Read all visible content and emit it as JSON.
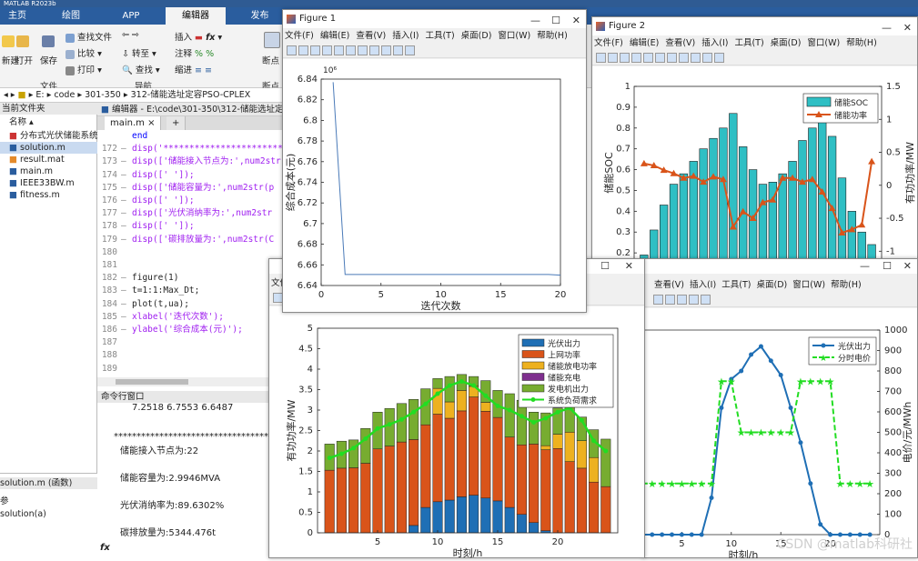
{
  "app": {
    "title_fragment": "MATLAB R2023b"
  },
  "ribbon": {
    "tabs": [
      "主页",
      "绘图",
      "APP",
      "编辑器",
      "发布"
    ],
    "active_tab": "编辑器",
    "buttons": {
      "new": "新建",
      "open": "打开",
      "save": "保存",
      "find_files": "查找文件",
      "compare": "比较",
      "print": "打印",
      "goto": "转至",
      "find": "查找",
      "insert": "插入",
      "comment": "注释",
      "indent": "缩进",
      "breakpoint": "断点"
    },
    "groups": {
      "file": "文件",
      "nav": "导航",
      "breakpoint": "断点"
    }
  },
  "address": {
    "path": [
      "E:",
      "code",
      "301-350",
      "312-储能选址定容PSO-CPLEX"
    ]
  },
  "file_browser": {
    "header": "当前文件夹",
    "col_name": "名称",
    "items": [
      "分布式光伏储能系统的...",
      "solution.m",
      "result.mat",
      "main.m",
      "IEEE33BW.m",
      "fitness.m"
    ],
    "selected": "solution.m",
    "detail_title": "solution.m (函数)",
    "detail_section": "参",
    "detail_item": "solution(a)"
  },
  "editor": {
    "header": "编辑器 - E:\\code\\301-350\\312-储能选址定容PSO-CPLEX\\main.m",
    "tab": "main.m",
    "lines": [
      {
        "n": "",
        "code": "end"
      },
      {
        "n": "172",
        "code": "disp('************************"
      },
      {
        "n": "173",
        "code": "disp(['储能接入节点为:',num2str"
      },
      {
        "n": "174",
        "code": "disp(['  ']);"
      },
      {
        "n": "175",
        "code": "disp(['储能容量为:',num2str(p"
      },
      {
        "n": "176",
        "code": "disp(['  ']);"
      },
      {
        "n": "177",
        "code": "disp(['光伏消纳率为:',num2str"
      },
      {
        "n": "178",
        "code": "disp(['  ']);"
      },
      {
        "n": "179",
        "code": "disp(['碳排放量为:',num2str(C"
      },
      {
        "n": "180",
        "code": ""
      },
      {
        "n": "181",
        "code": ""
      },
      {
        "n": "182",
        "code": "figure(1)"
      },
      {
        "n": "183",
        "code": "t=1:1:Max_Dt;"
      },
      {
        "n": "184",
        "code": "plot(t,ua);"
      },
      {
        "n": "185",
        "code": "xlabel('迭代次数');"
      },
      {
        "n": "186",
        "code": "ylabel('综合成本(元)');"
      },
      {
        "n": "187",
        "code": ""
      },
      {
        "n": "188",
        "code": ""
      },
      {
        "n": "189",
        "code": ""
      }
    ]
  },
  "command_window": {
    "header": "命令行窗口",
    "lines": [
      "7.2518      6.7553      6.6487",
      "***********************************",
      "储能接入节点为:22",
      "储能容量为:2.9946MVA",
      "光伏消纳率为:89.6302%",
      "碳排放量为:5344.476t"
    ],
    "prompt": "fx"
  },
  "figure_menu": [
    "文件(F)",
    "编辑(E)",
    "查看(V)",
    "插入(I)",
    "工具(T)",
    "桌面(D)",
    "窗口(W)",
    "帮助(H)"
  ],
  "figures": {
    "fig1_title": "Figure 1",
    "fig2_title": "Figure 2",
    "fig3_menu_partial": [
      "文件"
    ],
    "fig4_menu_partial": [
      "查看(V)",
      "插入(I)",
      "工具(T)",
      "桌面(D)",
      "窗口(W)",
      "帮助(H)"
    ]
  },
  "watermark": "CSDN @matlab科研社",
  "chart_data": [
    {
      "type": "line",
      "id": "convergence",
      "x": [
        1,
        2,
        3,
        4,
        5,
        6,
        7,
        8,
        9,
        10,
        11,
        12,
        13,
        14,
        15,
        16,
        17,
        18,
        19,
        20
      ],
      "values": [
        6.837,
        6.6507,
        6.6507,
        6.6507,
        6.6507,
        6.6507,
        6.6507,
        6.6507,
        6.6507,
        6.6507,
        6.6507,
        6.6507,
        6.6507,
        6.6507,
        6.6507,
        6.6507,
        6.6507,
        6.6507,
        6.6507,
        6.65
      ],
      "xlabel": "迭代次数",
      "ylabel": "综合成本(元)",
      "xlim": [
        0,
        20
      ],
      "ylim": [
        6.64,
        6.84
      ],
      "xticks": [
        "0",
        "5",
        "10",
        "15",
        "20"
      ],
      "yticks": [
        "6.64",
        "6.66",
        "6.68",
        "6.7",
        "6.72",
        "6.74",
        "6.76",
        "6.78",
        "6.8",
        "6.82",
        "6.84"
      ],
      "exponent": "10⁶",
      "color": "#4a7ab8"
    },
    {
      "type": "bar",
      "id": "soc",
      "categories": [
        1,
        2,
        3,
        4,
        5,
        6,
        7,
        8,
        9,
        10,
        11,
        12,
        13,
        14,
        15,
        16,
        17,
        18,
        19,
        20,
        21,
        22,
        23,
        24
      ],
      "series": [
        {
          "name": "储能SOC",
          "type": "bar",
          "color": "#2fbfc4",
          "values": [
            0.19,
            0.31,
            0.43,
            0.53,
            0.58,
            0.64,
            0.7,
            0.75,
            0.8,
            0.87,
            0.71,
            0.6,
            0.53,
            0.54,
            0.58,
            0.64,
            0.74,
            0.8,
            0.84,
            0.76,
            0.56,
            0.4,
            0.3,
            0.24
          ]
        },
        {
          "name": "储能功率",
          "type": "line",
          "axis": "right",
          "color": "#d9541a",
          "values": [
            0.33,
            0.3,
            0.23,
            0.18,
            0.11,
            0.14,
            0.05,
            0.13,
            0.09,
            -0.63,
            -0.4,
            -0.5,
            -0.26,
            -0.22,
            0.11,
            0.11,
            0.05,
            0.09,
            -0.1,
            -0.35,
            -0.72,
            -0.67,
            -0.6,
            0.36
          ]
        }
      ],
      "ylabel": "储能SOC",
      "ylabel_right": "有功功率/MW",
      "ylim": [
        0.17,
        1.0
      ],
      "ylim_right": [
        -1.12,
        1.5
      ],
      "yticks": [
        "0.2",
        "0.3",
        "0.4",
        "0.5",
        "0.6",
        "0.7",
        "0.8",
        "0.9",
        "1"
      ],
      "yticks_right": [
        "-1",
        "-0.5",
        "0",
        "0.5",
        "1",
        "1.5"
      ],
      "legend": "top-right"
    },
    {
      "type": "bar",
      "id": "power-balance",
      "categories": [
        1,
        2,
        3,
        4,
        5,
        6,
        7,
        8,
        9,
        10,
        11,
        12,
        13,
        14,
        15,
        16,
        17,
        18,
        19,
        20,
        21,
        22,
        23,
        24
      ],
      "series": [
        {
          "name": "光伏出力",
          "color": "#1f6fb5",
          "values": [
            0,
            0,
            0,
            0,
            0,
            0,
            0,
            0.18,
            0.62,
            0.76,
            0.8,
            0.88,
            0.92,
            0.85,
            0.78,
            0.62,
            0.45,
            0.25,
            0.05,
            0,
            0,
            0,
            0,
            0
          ]
        },
        {
          "name": "上网功率",
          "color": "#d9541a",
          "values": [
            1.53,
            1.58,
            1.59,
            1.7,
            2.05,
            2.12,
            2.22,
            2.1,
            2.02,
            2.14,
            2.0,
            2.1,
            2.4,
            2.12,
            2.04,
            1.72,
            1.7,
            1.92,
            1.98,
            2.06,
            1.74,
            1.58,
            1.24,
            1.13
          ]
        },
        {
          "name": "储能放电功率",
          "color": "#edb120",
          "values": [
            0,
            0,
            0,
            0,
            0,
            0,
            0,
            0,
            0,
            0.63,
            0.4,
            0.5,
            0.26,
            0.22,
            0,
            0,
            0,
            0,
            0.1,
            0.35,
            0.72,
            0.67,
            0.6,
            0
          ]
        },
        {
          "name": "储能充电",
          "color": "#7e2f8e",
          "values": [
            0,
            0,
            0,
            0,
            0,
            0,
            0,
            0,
            0,
            0,
            0,
            0,
            0,
            0,
            0,
            0,
            0,
            0,
            0,
            0,
            0,
            0,
            0,
            0
          ]
        },
        {
          "name": "发电机出力",
          "color": "#77ac30",
          "values": [
            0.64,
            0.66,
            0.68,
            0.85,
            0.9,
            0.92,
            0.94,
            0.98,
            0.88,
            0.24,
            0.62,
            0.39,
            0.24,
            0.53,
            0.66,
            1.06,
            1.09,
            0.78,
            0.8,
            0.64,
            0.7,
            0.58,
            0.68,
            1.16
          ]
        },
        {
          "name": "系统负荷需求",
          "type": "line",
          "color": "#22dd22",
          "values": [
            1.83,
            1.93,
            2.07,
            2.3,
            2.55,
            2.65,
            2.77,
            2.95,
            3.15,
            3.4,
            3.6,
            3.7,
            3.6,
            3.35,
            3.1,
            3.0,
            2.85,
            2.7,
            2.8,
            2.95,
            3.05,
            2.75,
            2.25,
            2.0
          ]
        }
      ],
      "xlabel": "时刻/h",
      "ylabel": "有功功率/MW",
      "ylim": [
        0,
        5
      ],
      "xticks": [
        "5",
        "10",
        "15",
        "20"
      ],
      "yticks": [
        "0",
        "0.5",
        "1",
        "1.5",
        "2",
        "2.5",
        "3",
        "3.5",
        "4",
        "4.5",
        "5"
      ],
      "legend": "top-right"
    },
    {
      "type": "line",
      "id": "pv-price",
      "x": [
        1,
        2,
        3,
        4,
        5,
        6,
        7,
        8,
        9,
        10,
        11,
        12,
        13,
        14,
        15,
        16,
        17,
        18,
        19,
        20,
        21,
        22,
        23,
        24
      ],
      "series": [
        {
          "name": "光伏出力",
          "color": "#1f6fb5",
          "values": [
            0,
            0,
            0,
            0,
            0,
            0,
            0,
            0.18,
            0.62,
            0.76,
            0.8,
            0.88,
            0.92,
            0.85,
            0.78,
            0.62,
            0.45,
            0.25,
            0.05,
            0,
            0,
            0,
            0,
            0
          ]
        },
        {
          "name": "分时电价",
          "color": "#22dd22",
          "axis": "right",
          "values": [
            250,
            250,
            250,
            250,
            250,
            250,
            250,
            250,
            750,
            750,
            500,
            500,
            500,
            500,
            500,
            500,
            750,
            750,
            750,
            750,
            250,
            250,
            250,
            250
          ]
        }
      ],
      "xlabel": "时刻/h",
      "ylabel_right": "电价/元/MWh",
      "ylim_right": [
        0,
        1000
      ],
      "yticks_right": [
        "0",
        "100",
        "200",
        "300",
        "400",
        "500",
        "600",
        "700",
        "800",
        "900",
        "1000"
      ],
      "xticks": [
        "5",
        "10",
        "15",
        "20"
      ],
      "legend": "top-right"
    }
  ]
}
